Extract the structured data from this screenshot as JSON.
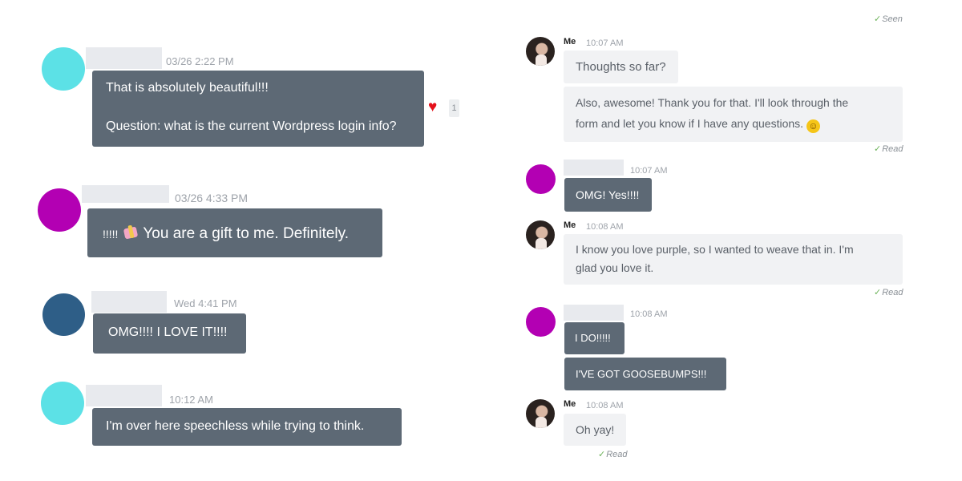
{
  "left_messages": [
    {
      "timestamp": "03/26 2:22 PM",
      "lines": [
        "That is absolutely beautiful!!!",
        "Question: what is the current Wordpress login info?"
      ],
      "reaction": {
        "icon": "heart-icon",
        "count": "1"
      },
      "avatar_color": "#5ce1e6"
    },
    {
      "timestamp": "03/26 4:33 PM",
      "prefix": "!!!!!",
      "text": "You are a gift to me. Definitely.",
      "emoji": "gift-heart-emoji",
      "avatar_color": "#b300b3"
    },
    {
      "timestamp": "Wed 4:41 PM",
      "text": "OMG!!!! I LOVE IT!!!!",
      "avatar_color": "#2e5e87"
    },
    {
      "timestamp": "10:12 AM",
      "text": "I'm over here speechless while trying to think.",
      "avatar_color": "#5ce1e6"
    }
  ],
  "right_thread": {
    "top_status": "Seen",
    "groups": [
      {
        "sender": "Me",
        "time": "10:07 AM",
        "messages": [
          {
            "text": "Thoughts so far?"
          },
          {
            "lines": [
              "Also, awesome! Thank you for that. I'll look through the",
              "form and let you know if I have any questions."
            ],
            "emoji": "smiley-emoji"
          }
        ],
        "status": "Read"
      },
      {
        "sender": "",
        "time": "10:07 AM",
        "avatar_color": "#b300b3",
        "messages": [
          {
            "text": "OMG! Yes!!!!"
          }
        ]
      },
      {
        "sender": "Me",
        "time": "10:08 AM",
        "messages": [
          {
            "lines": [
              "I know you love purple, so I wanted to weave that in. I'm",
              "glad you love it."
            ]
          }
        ],
        "status": "Read"
      },
      {
        "sender": "",
        "time": "10:08 AM",
        "avatar_color": "#b300b3",
        "messages": [
          {
            "text": "I DO!!!!!"
          },
          {
            "text": "I'VE GOT GOOSEBUMPS!!!"
          }
        ]
      },
      {
        "sender": "Me",
        "time": "10:08 AM",
        "messages": [
          {
            "text": "Oh yay!"
          }
        ],
        "status": "Read"
      }
    ]
  }
}
